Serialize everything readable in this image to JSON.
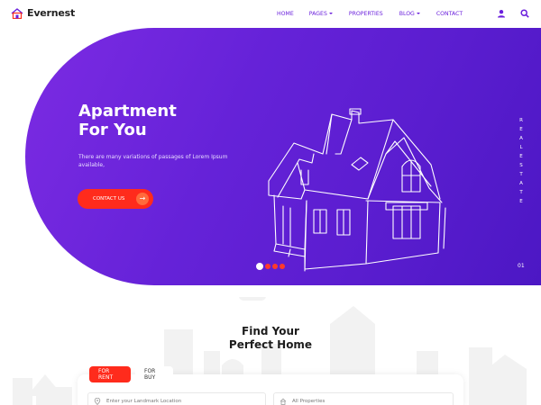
{
  "brand": {
    "name": "Evernest",
    "accent": "#6a1fdc",
    "red": "#ff2b1c"
  },
  "nav": {
    "items": [
      {
        "label": "HOME",
        "dropdown": false
      },
      {
        "label": "PAGES",
        "dropdown": true
      },
      {
        "label": "PROPERTIES",
        "dropdown": false
      },
      {
        "label": "BLOG",
        "dropdown": true
      },
      {
        "label": "CONTACT",
        "dropdown": false
      }
    ],
    "icons": [
      "user-icon",
      "search-icon"
    ]
  },
  "hero": {
    "title_line1": "Apartment",
    "title_line2": "For You",
    "description": "There are many variations of passages of Lorem Ipsum available,",
    "cta_label": "CONTACT US",
    "side_text": [
      "R",
      "E",
      "A",
      "L",
      "E",
      "S",
      "T",
      "A",
      "T",
      "E"
    ],
    "slide_number": "01",
    "slides": 4,
    "active_slide": 1
  },
  "search": {
    "title_line1": "Find Your",
    "title_line2": "Perfect Home",
    "tabs": [
      {
        "label": "FOR RENT",
        "active": true
      },
      {
        "label": "FOR BUY",
        "active": false
      }
    ],
    "location_placeholder": "Enter your Landmark Location",
    "type_value": "All Properties"
  }
}
